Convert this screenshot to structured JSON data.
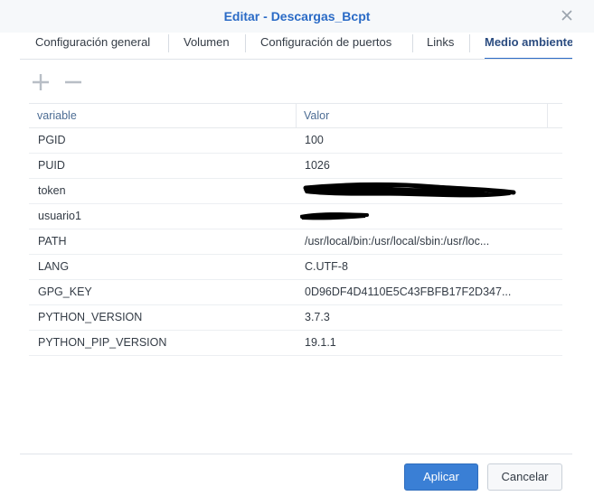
{
  "dialog": {
    "title": "Editar - Descargas_Bcpt"
  },
  "tabs": [
    {
      "label": "Configuración general"
    },
    {
      "label": "Volumen"
    },
    {
      "label": "Configuración de puertos"
    },
    {
      "label": "Links"
    },
    {
      "label": "Medio ambiente",
      "active": true
    }
  ],
  "toolbar": {
    "add_icon": "plus-icon",
    "remove_icon": "minus-icon"
  },
  "table": {
    "columns": [
      "variable",
      "Valor"
    ],
    "rows": [
      {
        "variable": "PGID",
        "valor": "100"
      },
      {
        "variable": "PUID",
        "valor": "1026"
      },
      {
        "variable": "token",
        "valor": ""
      },
      {
        "variable": "usuario1",
        "valor": ""
      },
      {
        "variable": "PATH",
        "valor": "/usr/local/bin:/usr/local/sbin:/usr/loc..."
      },
      {
        "variable": "LANG",
        "valor": "C.UTF-8"
      },
      {
        "variable": "GPG_KEY",
        "valor": "0D96DF4D4110E5C43FBFB17F2D347..."
      },
      {
        "variable": "PYTHON_VERSION",
        "valor": "3.7.3"
      },
      {
        "variable": "PYTHON_PIP_VERSION",
        "valor": "19.1.1"
      }
    ]
  },
  "footer": {
    "apply_label": "Aplicar",
    "cancel_label": "Cancelar"
  },
  "colors": {
    "accent": "#2b6bc6",
    "apply_button": "#3a7fd5",
    "header_text": "#4d6d94"
  }
}
